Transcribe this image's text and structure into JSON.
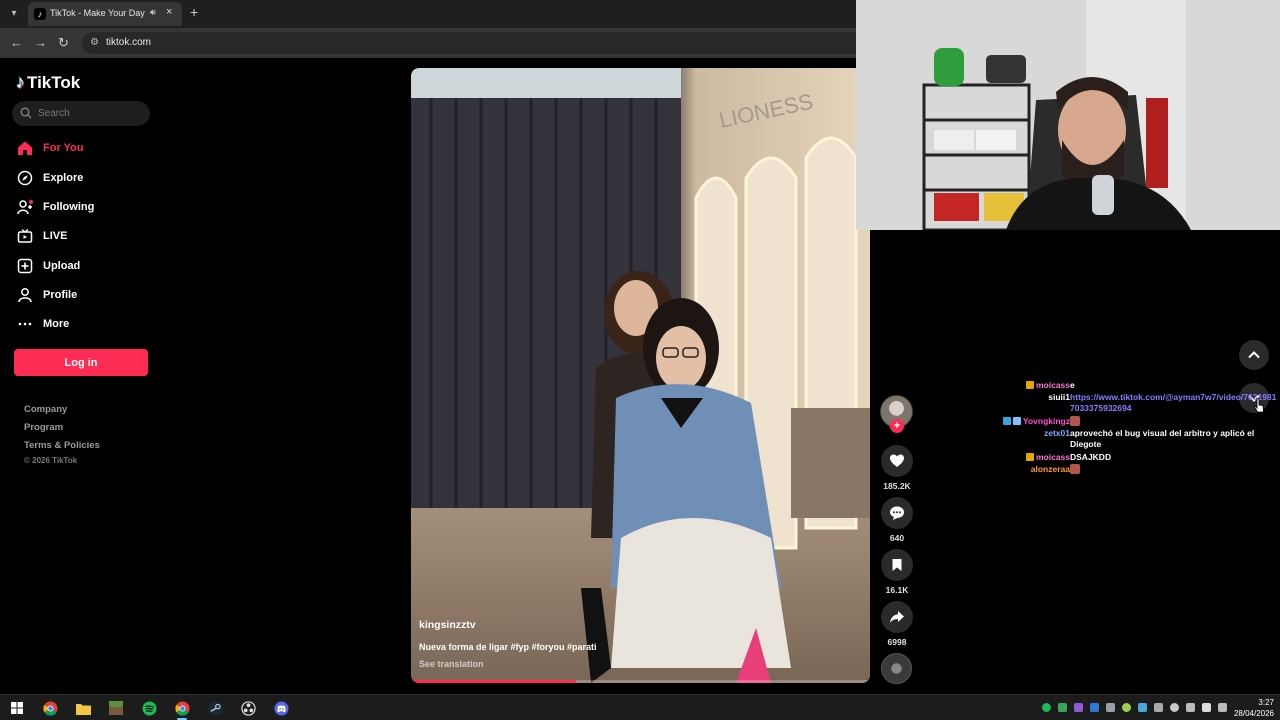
{
  "browser": {
    "tab_title": "TikTok - Make Your Day",
    "url": "tiktok.com",
    "icons": [
      "tab-list-icon",
      "audio-icon",
      "close-icon",
      "plus-icon",
      "back-arrow-icon",
      "forward-arrow-icon",
      "reload-icon",
      "site-info-icon"
    ]
  },
  "sidebar": {
    "logo_text": "TikTok",
    "search_placeholder": "Search",
    "nav": [
      {
        "label": "For You",
        "icon": "home-icon",
        "active": true
      },
      {
        "label": "Explore",
        "icon": "compass-icon"
      },
      {
        "label": "Following",
        "icon": "following-icon"
      },
      {
        "label": "LIVE",
        "icon": "live-icon"
      },
      {
        "label": "Upload",
        "icon": "upload-icon"
      },
      {
        "label": "Profile",
        "icon": "profile-icon"
      },
      {
        "label": "More",
        "icon": "more-icon"
      }
    ],
    "login_label": "Log in",
    "footer": [
      "Company",
      "Program",
      "Terms & Policies"
    ],
    "copyright": "© 2026 TikTok"
  },
  "video": {
    "username": "kingsinzztv",
    "caption": "Nueva forma de ligar #fyp #foryou #parati",
    "translate": "See translation",
    "progress": 0.36
  },
  "actions": {
    "likes": "185.2K",
    "comments": "640",
    "saves": "16.1K",
    "shares": "6998",
    "icons": [
      "heart-icon",
      "comment-icon",
      "bookmark-icon",
      "share-icon"
    ]
  },
  "chat": [
    {
      "user": "moicass",
      "color": "#ff6fd8",
      "message": "e",
      "badge": true
    },
    {
      "user": "siuii1",
      "color": "#ffffff",
      "message": "https://www.tiktok.com/@ayman7w7/video/76319817033375932694",
      "link": true
    },
    {
      "user": "Yovngkingz",
      "color": "#ff4fd0",
      "message": "",
      "emote": true,
      "badge": true
    },
    {
      "user": "zetx01",
      "color": "#7fa8ff",
      "message": "aprovechó el bug visual del arbitro y aplicó el Diegote"
    },
    {
      "user": "moicass",
      "color": "#ff6fd8",
      "message": "DSAJKDD",
      "badge": true
    },
    {
      "user": "alonzeraa",
      "color": "#ff9a3c",
      "message": "",
      "emote": true
    }
  ],
  "taskbar": {
    "apps": [
      "windows-start-icon",
      "chrome-icon",
      "file-explorer-icon",
      "minecraft-icon",
      "spotify-icon",
      "chrome-active-icon",
      "steam-icon",
      "obs-icon",
      "discord-icon"
    ],
    "time": "3:27",
    "date": "28/04/2026"
  },
  "colors": {
    "accent": "#fe2c55",
    "background": "#000000"
  }
}
